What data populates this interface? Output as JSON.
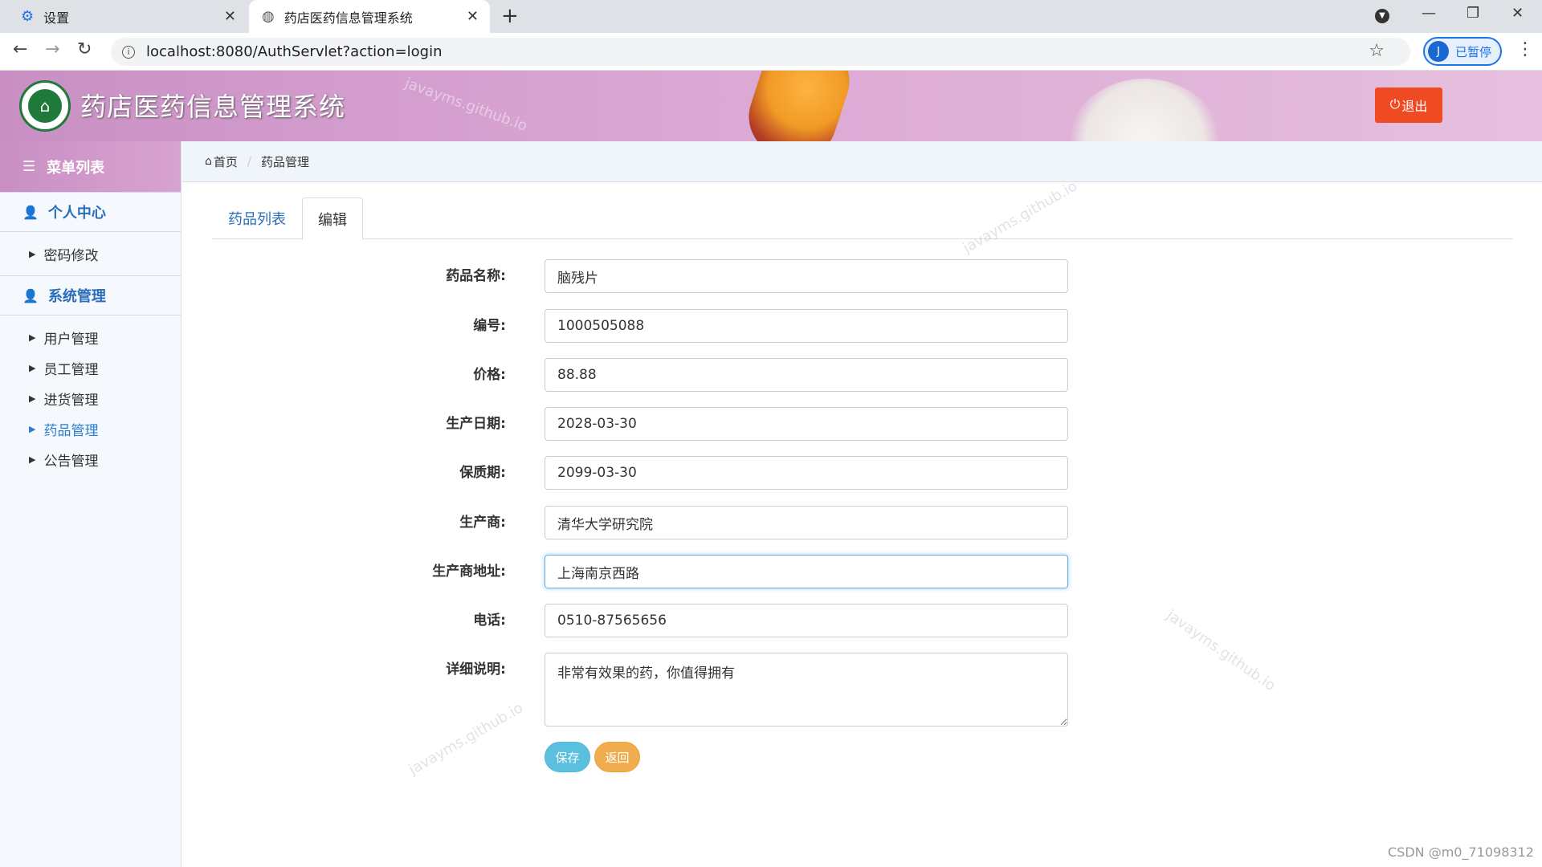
{
  "browser": {
    "tabs": [
      {
        "label": "设置"
      },
      {
        "label": "药店医药信息管理系统"
      }
    ],
    "url": "localhost:8080/AuthServlet?action=login",
    "profile_initial": "J",
    "profile_label": "已暂停"
  },
  "header": {
    "title": "药店医药信息管理系统",
    "logout_label": "退出",
    "logo_glyph": "⌂"
  },
  "sidebar": {
    "title": "菜单列表",
    "groups": [
      {
        "title": "个人中心",
        "items": [
          "密码修改"
        ]
      },
      {
        "title": "系统管理",
        "items": [
          "用户管理",
          "员工管理",
          "进货管理",
          "药品管理",
          "公告管理"
        ]
      }
    ],
    "active_item": "药品管理"
  },
  "breadcrumb": {
    "home": "首页",
    "current": "药品管理"
  },
  "tabs": {
    "list_label": "药品列表",
    "edit_label": "编辑"
  },
  "form": {
    "fields": [
      {
        "label": "药品名称:",
        "value": "脑残片"
      },
      {
        "label": "编号:",
        "value": "1000505088"
      },
      {
        "label": "价格:",
        "value": "88.88"
      },
      {
        "label": "生产日期:",
        "value": "2028-03-30"
      },
      {
        "label": "保质期:",
        "value": "2099-03-30"
      },
      {
        "label": "生产商:",
        "value": "清华大学研究院"
      },
      {
        "label": "生产商地址:",
        "value": "上海南京西路"
      },
      {
        "label": "电话:",
        "value": "0510-87565656"
      }
    ],
    "description": {
      "label": "详细说明:",
      "value": "非常有效果的药，你值得拥有"
    },
    "save_label": "保存",
    "back_label": "返回"
  },
  "watermark": "javayms.github.io",
  "footer_credit": "CSDN @m0_71098312"
}
